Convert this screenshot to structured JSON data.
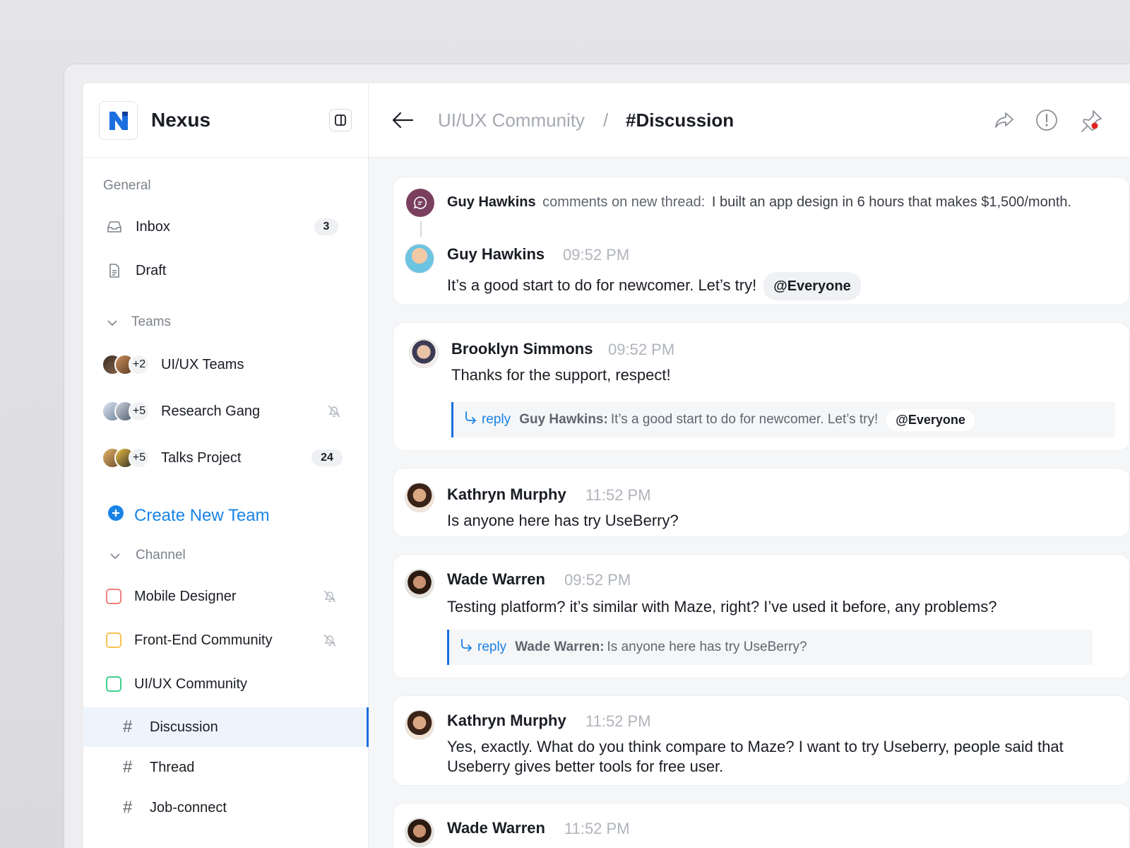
{
  "app": {
    "name": "Nexus"
  },
  "sidebar": {
    "general_label": "General",
    "inbox": {
      "label": "Inbox",
      "count": "3"
    },
    "draft": {
      "label": "Draft"
    },
    "teams_label": "Teams",
    "teams": [
      {
        "name": "UI/UX Teams",
        "more": "+2"
      },
      {
        "name": "Research Gang",
        "more": "+5"
      },
      {
        "name": "Talks Project",
        "more": "+5",
        "count": "24"
      }
    ],
    "create_team": "Create New Team",
    "channel_label": "Channel",
    "channels": [
      {
        "name": "Mobile Designer",
        "color": "#f08080"
      },
      {
        "name": "Front-End Community",
        "color": "#f5c451"
      },
      {
        "name": "UI/UX Community",
        "color": "#3ecf8e"
      }
    ],
    "subchannels": [
      {
        "name": "Discussion",
        "active": true
      },
      {
        "name": "Thread"
      },
      {
        "name": "Job-connect"
      }
    ]
  },
  "header": {
    "crumb": "UI/UX Community",
    "separator": "/",
    "current": "#Discussion"
  },
  "thread_intro": {
    "author": "Guy Hawkins",
    "action": "comments on new thread:",
    "title": "I built an app design in 6 hours that makes $1,500/month."
  },
  "messages": [
    {
      "author": "Guy Hawkins",
      "time": "09:52 PM",
      "text": "It’s a good start to do for newcomer. Let’s try!",
      "mention": "@Everyone"
    },
    {
      "author": "Brooklyn Simmons",
      "time": "09:52 PM",
      "text": "Thanks for the support, respect!",
      "reply": {
        "label": "reply",
        "author": "Guy Hawkins:",
        "text": "It’s a good start to do for newcomer. Let’s try!",
        "mention": "@Everyone"
      }
    },
    {
      "author": "Kathryn Murphy",
      "time": "11:52 PM",
      "text": "Is anyone here has try UseBerry?"
    },
    {
      "author": "Wade Warren",
      "time": "09:52 PM",
      "text": "Testing platform? it’s similar with Maze, right? I’ve used it before, any problems?",
      "reply": {
        "label": "reply",
        "author": "Wade Warren:",
        "text": "Is anyone here has try UseBerry?"
      }
    },
    {
      "author": "Kathryn Murphy",
      "time": "11:52 PM",
      "text": "Yes, exactly. What do you think compare to Maze? I want to try Useberry, people said that Useberry gives better tools for free user."
    },
    {
      "author": "Wade Warren",
      "time": "11:52 PM",
      "text": ""
    }
  ],
  "colors": {
    "accent": "#1a6ee0",
    "link": "#1a83e6",
    "active_bg": "#eef4fc"
  }
}
